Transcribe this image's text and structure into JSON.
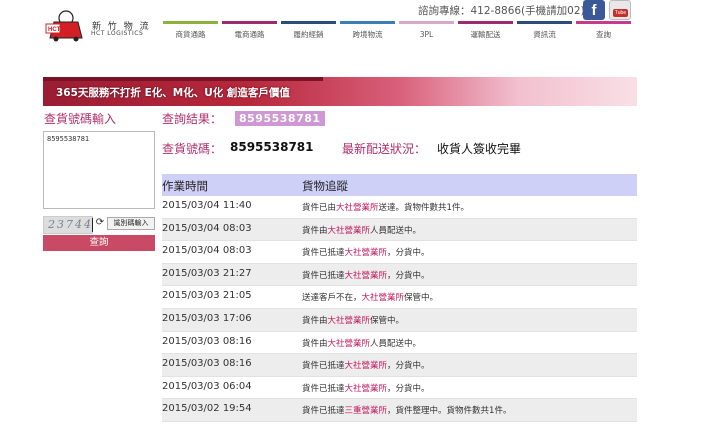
{
  "header": {
    "logo_zh": "新 竹 物 流",
    "logo_en": "HCT LOGISTICS",
    "hotline": "諮詢專線：412-8866(手機請加02)",
    "nav": [
      {
        "label": "商貨通路",
        "color": "#8fb23d"
      },
      {
        "label": "電商通路",
        "color": "#9b2c6d"
      },
      {
        "label": "履約經銷",
        "color": "#2a4d7e"
      },
      {
        "label": "跨境物流",
        "color": "#3b7fb5"
      },
      {
        "label": "3PL",
        "color": "#d8a8c8"
      },
      {
        "label": "運輸配送",
        "color": "#9b2c6d"
      },
      {
        "label": "資訊流",
        "color": "#2a4d7e"
      },
      {
        "label": "查詢",
        "color": "#c63a8f"
      }
    ]
  },
  "banner": {
    "text": "365天服務不打折 E化、M化、U化 創造客戶價值"
  },
  "left": {
    "title": "查貨號碼輸入",
    "query_value": "8595538781",
    "captcha_text": "23744",
    "captcha_button": "識別碼輸入",
    "search_button": "查詢"
  },
  "result": {
    "label": "查詢結果：",
    "value": "8595538781",
    "no_label": "查貨號碼：",
    "no_value": "8595538781",
    "status_label": "最新配送狀況：",
    "status_value": "收貨人簽收完畢"
  },
  "table": {
    "col_time": "作業時間",
    "col_track": "貨物追蹤",
    "rows": [
      {
        "time": "2015/03/04 11:40",
        "pre": "貨件已由",
        "station": "大社營業所",
        "post": "送達。貨物件數共1件。"
      },
      {
        "time": "2015/03/04 08:03",
        "pre": "貨件由",
        "station": "大社營業所",
        "post": "人員配送中。"
      },
      {
        "time": "2015/03/04 08:03",
        "pre": "貨件已抵達",
        "station": "大社營業所",
        "post": "，分貨中。"
      },
      {
        "time": "2015/03/03 21:27",
        "pre": "貨件已抵達",
        "station": "大社營業所",
        "post": "，分貨中。"
      },
      {
        "time": "2015/03/03 21:05",
        "pre": "送達客戶不在，",
        "station": "大社營業所",
        "post": "保管中。"
      },
      {
        "time": "2015/03/03 17:06",
        "pre": "貨件由",
        "station": "大社營業所",
        "post": "保管中。"
      },
      {
        "time": "2015/03/03 08:16",
        "pre": "貨件由",
        "station": "大社營業所",
        "post": "人員配送中。"
      },
      {
        "time": "2015/03/03 08:16",
        "pre": "貨件已抵達",
        "station": "大社營業所",
        "post": "，分貨中。"
      },
      {
        "time": "2015/03/03 06:04",
        "pre": "貨件已抵達",
        "station": "大社營業所",
        "post": "，分貨中。"
      },
      {
        "time": "2015/03/02 19:54",
        "pre": "貨件已抵達",
        "station": "三重營業所",
        "post": "，貨件整理中。貨物件數共1件。"
      }
    ]
  }
}
